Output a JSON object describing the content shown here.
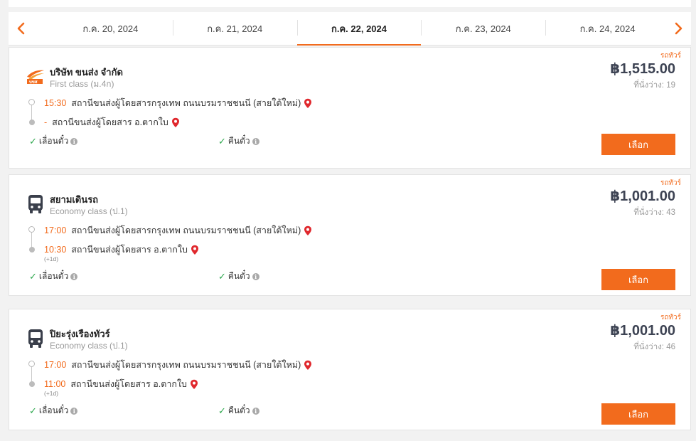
{
  "date_nav": {
    "prev_icon": "chevron-left-icon",
    "next_icon": "chevron-right-icon",
    "dates": [
      "ก.ค. 20, 2024",
      "ก.ค. 21, 2024",
      "ก.ค. 22, 2024",
      "ก.ค. 23, 2024",
      "ก.ค. 24, 2024"
    ],
    "active_index": 2
  },
  "colors": {
    "accent": "#f26b1d",
    "check": "#2fa84f",
    "pin": "#e0282d",
    "price": "#3d4353"
  },
  "trips": [
    {
      "operator": "บริษัท ขนส่ง จำกัด",
      "logo": "bks-logo",
      "class": "First class (ม.4ก)",
      "tag": "รถทัวร์",
      "price": "฿1,515.00",
      "seats": "ที่นั่งว่าง: 19",
      "depart_time": "15:30",
      "depart_station": "สถานีขนส่งผู้โดยสารกรุงเทพ ถนนบรมราชชนนี (สายใต้ใหม่)",
      "arrive_time": "-",
      "arrive_station": "สถานีขนส่งผู้โดยสาร อ.ตากใบ",
      "next_day": "",
      "policy_change": "เลื่อนตั๋ว",
      "policy_refund": "คืนตั๋ว",
      "button": "เลือก"
    },
    {
      "operator": "สยามเดินรถ",
      "logo": "bus-icon",
      "class": "Economy class (ป.1)",
      "tag": "รถทัวร์",
      "price": "฿1,001.00",
      "seats": "ที่นั่งว่าง: 43",
      "depart_time": "17:00",
      "depart_station": "สถานีขนส่งผู้โดยสารกรุงเทพ ถนนบรมราชชนนี (สายใต้ใหม่)",
      "arrive_time": "10:30",
      "arrive_station": "สถานีขนส่งผู้โดยสาร อ.ตากใบ",
      "next_day": "(+1d)",
      "policy_change": "เลื่อนตั๋ว",
      "policy_refund": "คืนตั๋ว",
      "button": "เลือก"
    },
    {
      "operator": "ปิยะรุ่งเรืองทัวร์",
      "logo": "bus-icon",
      "class": "Economy class (ป.1)",
      "tag": "รถทัวร์",
      "price": "฿1,001.00",
      "seats": "ที่นั่งว่าง: 46",
      "depart_time": "17:00",
      "depart_station": "สถานีขนส่งผู้โดยสารกรุงเทพ ถนนบรมราชชนนี (สายใต้ใหม่)",
      "arrive_time": "11:00",
      "arrive_station": "สถานีขนส่งผู้โดยสาร อ.ตากใบ",
      "next_day": "(+1d)",
      "policy_change": "เลื่อนตั๋ว",
      "policy_refund": "คืนตั๋ว",
      "button": "เลือก"
    }
  ]
}
